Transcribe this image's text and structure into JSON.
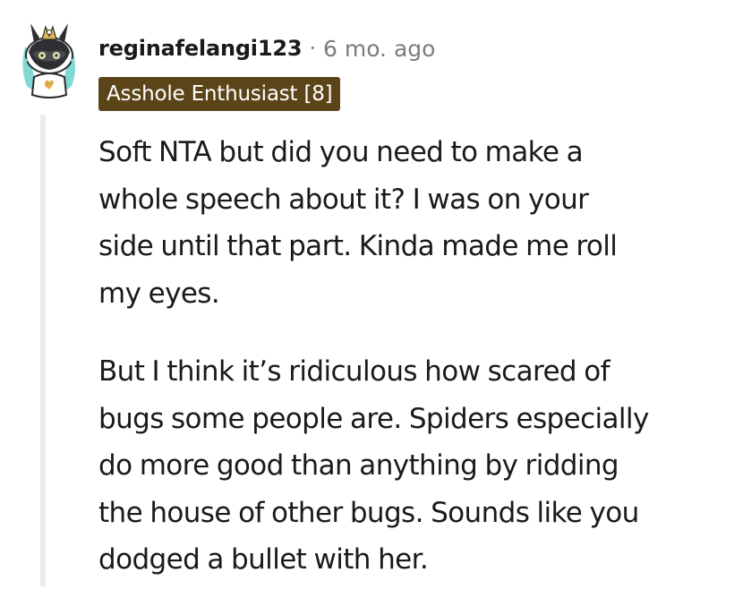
{
  "comment": {
    "author": "reginafelangi123",
    "separator": "·",
    "timestamp": "6 mo. ago",
    "flair": "Asshole Enthusiast [8]",
    "avatar_icon": "snoo-avatar-icon",
    "paragraphs": [
      {
        "lines": [
          "Soft NTA but did you need to make a",
          "whole speech about it? I was on your",
          "side until that part. Kinda made me roll",
          "my eyes."
        ]
      },
      {
        "lines": [
          "But I think it’s ridiculous how scared of",
          "bugs some people are. Spiders especially",
          "do more good than anything by ridding",
          "the house of other bugs. Sounds like you",
          "dodged a bullet with her."
        ]
      }
    ]
  },
  "colors": {
    "flair_background": "#5c4419",
    "flair_text": "#ffffff",
    "meta_text": "#7c7c7c",
    "thread_line": "#ececec"
  }
}
